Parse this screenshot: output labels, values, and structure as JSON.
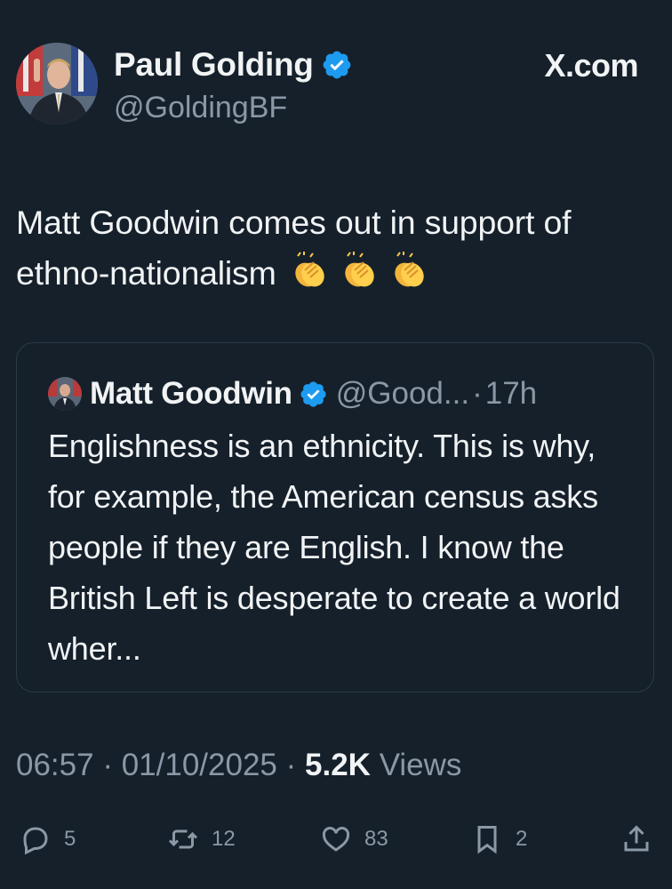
{
  "author": {
    "name": "Paul Golding",
    "handle": "@GoldingBF",
    "verified_color": "#1d9bf0"
  },
  "brand": "X.com",
  "tweet": {
    "text": "Matt Goodwin comes out in support of ethno-nationalism",
    "emoji": [
      "clapping-hands",
      "clapping-hands",
      "clapping-hands"
    ]
  },
  "quote": {
    "name": "Matt Goodwin",
    "handle": "@Good...",
    "separator": "·",
    "time": "17h",
    "text": "Englishness is an ethnicity. This is why, for example, the American census asks people if they are English. I know the British Left is desperate to create a world wher..."
  },
  "meta": {
    "time": "06:57",
    "sep1": "·",
    "date": "01/10/2025",
    "sep2": "·",
    "views_count": "5.2K",
    "views_label": "Views"
  },
  "actions": {
    "replies": "5",
    "reposts": "12",
    "likes": "83",
    "bookmarks": "2"
  },
  "colors": {
    "background": "#15202b",
    "text": "#f1f3f4",
    "secondary": "#8b98a5",
    "border": "#2c3a48"
  }
}
